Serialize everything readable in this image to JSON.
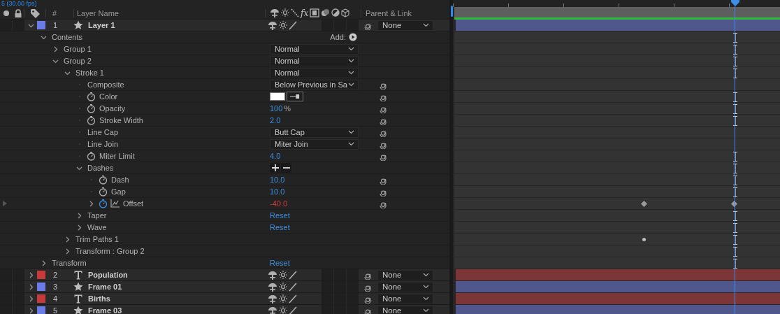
{
  "composition": {
    "frame_rate": "5 (30.00 fps)"
  },
  "header": {
    "number": "#",
    "layer_name": "Layer Name",
    "fx": "fx",
    "parent": "Parent & Link"
  },
  "layers": [
    {
      "number": "1",
      "name": "Layer 1",
      "kind": "shape",
      "color": "#6b7ce8",
      "expanded": true,
      "parent": "None",
      "properties": [
        {
          "name": "Contents",
          "expanded": true,
          "stopwatch": false,
          "link": false,
          "value": {
            "kind": "add",
            "text": "Add:"
          },
          "track": {
            "kind": "span"
          },
          "children": [
            {
              "name": "Group 1",
              "expanded": false,
              "stopwatch": false,
              "link": false,
              "value": {
                "kind": "dropdown",
                "text": "Normal"
              },
              "track": {
                "kind": "span"
              }
            },
            {
              "name": "Group 2",
              "expanded": true,
              "stopwatch": false,
              "link": false,
              "value": {
                "kind": "dropdown",
                "text": "Normal"
              },
              "track": {
                "kind": "span"
              },
              "children": [
                {
                  "name": "Stroke 1",
                  "expanded": true,
                  "stopwatch": false,
                  "link": false,
                  "value": {
                    "kind": "dropdown",
                    "text": "Normal"
                  },
                  "track": {
                    "kind": "span"
                  },
                  "children": [
                    {
                      "name": "Composite",
                      "stopwatch": false,
                      "link": true,
                      "value": {
                        "kind": "dropdown",
                        "text": "Below Previous in Sa"
                      }
                    },
                    {
                      "name": "Color",
                      "stopwatch": true,
                      "animated": false,
                      "link": true,
                      "value": {
                        "kind": "color",
                        "color": "#ffffff"
                      },
                      "track": {
                        "kind": "span"
                      }
                    },
                    {
                      "name": "Opacity",
                      "stopwatch": true,
                      "animated": false,
                      "link": true,
                      "value": {
                        "kind": "number",
                        "text": "100",
                        "unit": "%"
                      },
                      "track": {
                        "kind": "span"
                      }
                    },
                    {
                      "name": "Stroke Width",
                      "stopwatch": true,
                      "animated": false,
                      "link": true,
                      "value": {
                        "kind": "number",
                        "text": "2.0"
                      },
                      "track": {
                        "kind": "span"
                      }
                    },
                    {
                      "name": "Line Cap",
                      "stopwatch": false,
                      "link": true,
                      "value": {
                        "kind": "dropdown",
                        "text": "Butt Cap"
                      }
                    },
                    {
                      "name": "Line Join",
                      "stopwatch": false,
                      "link": true,
                      "value": {
                        "kind": "dropdown",
                        "text": "Miter Join"
                      }
                    },
                    {
                      "name": "Miter Limit",
                      "stopwatch": true,
                      "animated": false,
                      "link": true,
                      "value": {
                        "kind": "number",
                        "text": "4.0"
                      },
                      "track": {
                        "kind": "span"
                      }
                    },
                    {
                      "name": "Dashes",
                      "expanded": true,
                      "stopwatch": false,
                      "link": false,
                      "value": {
                        "kind": "plusminus"
                      },
                      "track": {
                        "kind": "span"
                      },
                      "children": [
                        {
                          "name": "Dash",
                          "stopwatch": true,
                          "animated": false,
                          "link": true,
                          "value": {
                            "kind": "number",
                            "text": "10.0"
                          },
                          "track": {
                            "kind": "span"
                          }
                        },
                        {
                          "name": "Gap",
                          "stopwatch": true,
                          "animated": false,
                          "link": true,
                          "value": {
                            "kind": "number",
                            "text": "10.0"
                          },
                          "track": {
                            "kind": "span"
                          }
                        },
                        {
                          "name": "Offset",
                          "expanded": false,
                          "stopwatch": true,
                          "animated": true,
                          "link": true,
                          "value": {
                            "kind": "number",
                            "text": "-40.0"
                          },
                          "track": {
                            "kind": "keyframes"
                          }
                        }
                      ]
                    },
                    {
                      "name": "Taper",
                      "expanded": false,
                      "stopwatch": false,
                      "link": false,
                      "value": {
                        "kind": "reset",
                        "text": "Reset"
                      },
                      "track": {
                        "kind": "span"
                      }
                    },
                    {
                      "name": "Wave",
                      "expanded": false,
                      "stopwatch": false,
                      "link": false,
                      "value": {
                        "kind": "reset",
                        "text": "Reset"
                      },
                      "track": {
                        "kind": "span"
                      }
                    }
                  ]
                },
                {
                  "name": "Trim Paths 1",
                  "expanded": false,
                  "stopwatch": false,
                  "link": false,
                  "track": {
                    "kind": "dots"
                  }
                },
                {
                  "name": "Transform : Group 2",
                  "expanded": false,
                  "stopwatch": false,
                  "link": false,
                  "track": {
                    "kind": "span"
                  }
                }
              ]
            }
          ]
        },
        {
          "name": "Transform",
          "expanded": false,
          "stopwatch": false,
          "link": false,
          "value": {
            "kind": "reset",
            "text": "Reset"
          },
          "track": {
            "kind": "span"
          }
        }
      ]
    },
    {
      "number": "2",
      "name": "Population",
      "kind": "text",
      "color": "#c8393b",
      "expanded": false,
      "parent": "None"
    },
    {
      "number": "3",
      "name": "Frame 01",
      "kind": "shape",
      "color": "#6b7ce8",
      "expanded": false,
      "parent": "None"
    },
    {
      "number": "4",
      "name": "Births",
      "kind": "text",
      "color": "#c8393b",
      "expanded": false,
      "parent": "None"
    },
    {
      "number": "5",
      "name": "Frame 03",
      "kind": "shape",
      "color": "#6b7ce8",
      "expanded": false,
      "parent": "None"
    }
  ]
}
